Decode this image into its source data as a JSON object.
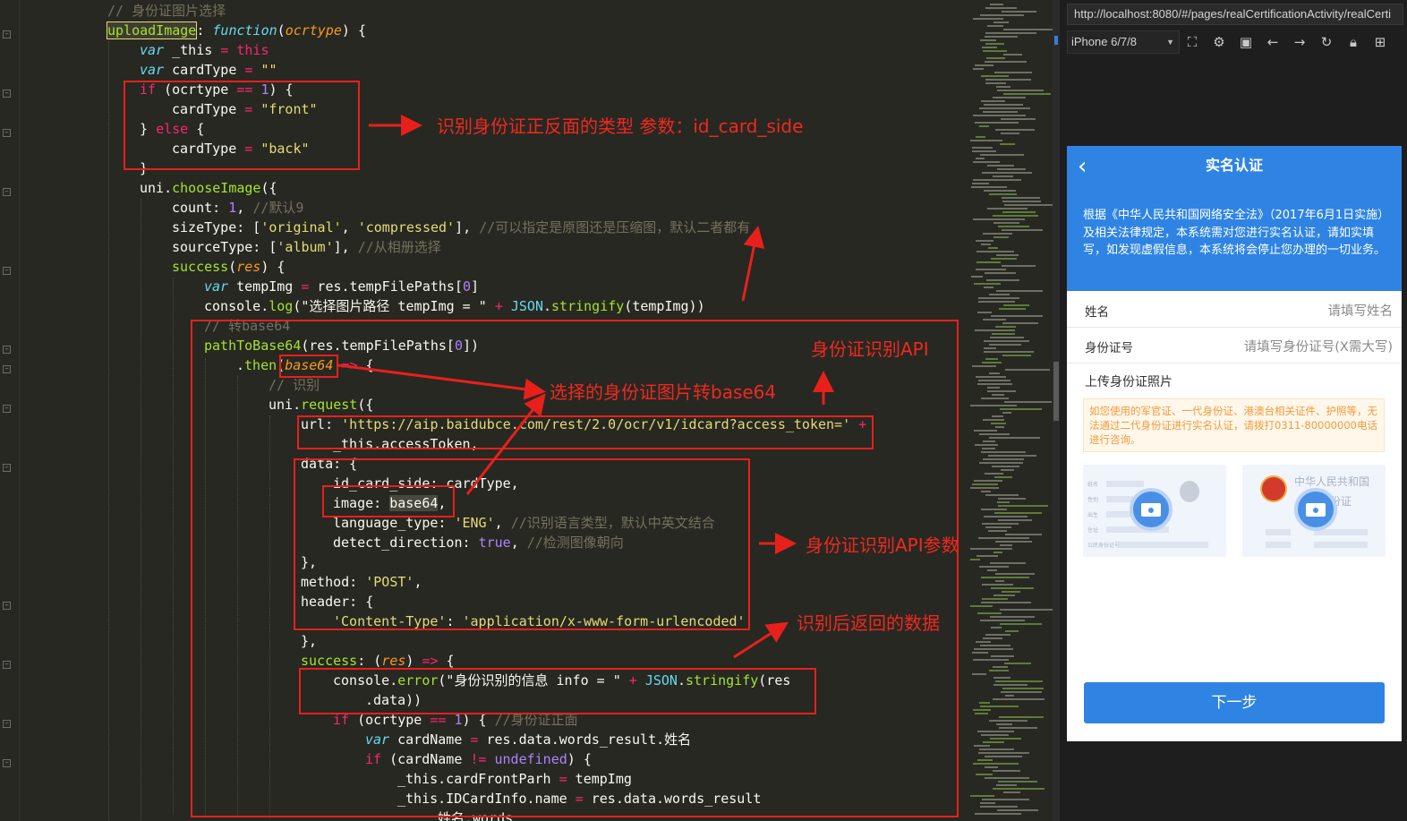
{
  "editor": {
    "lines": [
      [
        [
          "cm",
          "// 身份证图片选择"
        ]
      ],
      [
        [
          "sel",
          "uploadImage"
        ],
        [
          "prop",
          ": "
        ],
        [
          "kw",
          "function"
        ],
        [
          "prop",
          "("
        ],
        [
          "par",
          "ocrtype"
        ],
        [
          "prop",
          ") {"
        ]
      ],
      [
        [
          "kw",
          "var"
        ],
        [
          "prop",
          " _this "
        ],
        [
          "op",
          "="
        ],
        [
          "prop",
          " "
        ],
        [
          "op",
          "this"
        ]
      ],
      [
        [
          "kw",
          "var"
        ],
        [
          "prop",
          " cardType "
        ],
        [
          "op",
          "="
        ],
        [
          "prop",
          " "
        ],
        [
          "str",
          "\"\""
        ]
      ],
      [
        [
          "op",
          "if"
        ],
        [
          "prop",
          " (ocrtype "
        ],
        [
          "op",
          "=="
        ],
        [
          "prop",
          " "
        ],
        [
          "num",
          "1"
        ],
        [
          "prop",
          ") {"
        ]
      ],
      [
        [
          "prop",
          "cardType "
        ],
        [
          "op",
          "="
        ],
        [
          "prop",
          " "
        ],
        [
          "str",
          "\"front\""
        ]
      ],
      [
        [
          "prop",
          "} "
        ],
        [
          "op",
          "else"
        ],
        [
          "prop",
          " {"
        ]
      ],
      [
        [
          "prop",
          "cardType "
        ],
        [
          "op",
          "="
        ],
        [
          "prop",
          " "
        ],
        [
          "str",
          "\"back\""
        ]
      ],
      [
        [
          "prop",
          "}"
        ]
      ],
      [
        [
          "prop",
          "uni."
        ],
        [
          "fn",
          "chooseImage"
        ],
        [
          "prop",
          "({"
        ]
      ],
      [
        [
          "prop",
          "count: "
        ],
        [
          "num",
          "1"
        ],
        [
          "prop",
          ", "
        ],
        [
          "cm",
          "//默认9"
        ]
      ],
      [
        [
          "prop",
          "sizeType: ["
        ],
        [
          "str",
          "'original'"
        ],
        [
          "prop",
          ", "
        ],
        [
          "str",
          "'compressed'"
        ],
        [
          "prop",
          "], "
        ],
        [
          "cm",
          "//可以指定是原图还是压缩图，默认二者都有"
        ]
      ],
      [
        [
          "prop",
          "sourceType: ["
        ],
        [
          "str",
          "'album'"
        ],
        [
          "prop",
          "], "
        ],
        [
          "cm",
          "//从相册选择"
        ]
      ],
      [
        [
          "fn",
          "success"
        ],
        [
          "prop",
          "("
        ],
        [
          "par",
          "res"
        ],
        [
          "prop",
          ") {"
        ]
      ],
      [
        [
          "kw",
          "var"
        ],
        [
          "prop",
          " tempImg "
        ],
        [
          "op",
          "="
        ],
        [
          "prop",
          " res.tempFilePaths["
        ],
        [
          "num",
          "0"
        ],
        [
          "prop",
          "]"
        ]
      ],
      [
        [
          "prop",
          "console."
        ],
        [
          "fn",
          "log"
        ],
        [
          "prop",
          "(\"选择图片路径 tempImg = \" "
        ],
        [
          "op",
          "+"
        ],
        [
          "prop",
          " "
        ],
        [
          "obj",
          "JSON"
        ],
        [
          "prop",
          "."
        ],
        [
          "fn",
          "stringify"
        ],
        [
          "prop",
          "(tempImg))"
        ]
      ],
      [
        [
          "cm",
          "// 转base64"
        ]
      ],
      [
        [
          "fn",
          "pathToBase64"
        ],
        [
          "prop",
          "(res.tempFilePaths["
        ],
        [
          "num",
          "0"
        ],
        [
          "prop",
          "])"
        ]
      ],
      [
        [
          "prop",
          "."
        ],
        [
          "fn",
          "then"
        ],
        [
          "prop",
          "("
        ],
        [
          "par",
          "base64"
        ],
        [
          "prop",
          " "
        ],
        [
          "op",
          "=>"
        ],
        [
          "prop",
          " {"
        ]
      ],
      [
        [
          "cm",
          "// 识别"
        ]
      ],
      [
        [
          "prop",
          "uni."
        ],
        [
          "fn",
          "request"
        ],
        [
          "prop",
          "({"
        ]
      ],
      [
        [
          "prop",
          "url: "
        ],
        [
          "str",
          "'https://aip.baidubce.com/rest/2.0/ocr/v1/idcard?access_token='"
        ],
        [
          "prop",
          " "
        ],
        [
          "op",
          "+"
        ]
      ],
      [
        [
          "prop",
          "_this.accessToken,"
        ]
      ],
      [
        [
          "prop",
          "data: {"
        ]
      ],
      [
        [
          "prop",
          "id_card_side: cardType,"
        ]
      ],
      [
        [
          "prop",
          "image: "
        ],
        [
          "hl",
          "base64"
        ],
        [
          "prop",
          ","
        ]
      ],
      [
        [
          "prop",
          "language_type: "
        ],
        [
          "str",
          "'ENG'"
        ],
        [
          "prop",
          ", "
        ],
        [
          "cm",
          "//识别语言类型，默认中英文结合"
        ]
      ],
      [
        [
          "prop",
          "detect_direction: "
        ],
        [
          "num",
          "true"
        ],
        [
          "prop",
          ", "
        ],
        [
          "cm",
          "//检测图像朝向"
        ]
      ],
      [
        [
          "prop",
          "},"
        ]
      ],
      [
        [
          "prop",
          "method: "
        ],
        [
          "str",
          "'POST'"
        ],
        [
          "prop",
          ","
        ]
      ],
      [
        [
          "prop",
          "header: {"
        ]
      ],
      [
        [
          "str",
          "'Content-Type'"
        ],
        [
          "prop",
          ": "
        ],
        [
          "str",
          "'application/x-www-form-urlencoded'"
        ]
      ],
      [
        [
          "prop",
          "},"
        ]
      ],
      [
        [
          "fn",
          "success"
        ],
        [
          "prop",
          ": ("
        ],
        [
          "par",
          "res"
        ],
        [
          "prop",
          ") "
        ],
        [
          "op",
          "=>"
        ],
        [
          "prop",
          " {"
        ]
      ],
      [
        [
          "prop",
          "console."
        ],
        [
          "fn",
          "error"
        ],
        [
          "prop",
          "(\"身份识别的信息 info = \" "
        ],
        [
          "op",
          "+"
        ],
        [
          "prop",
          " "
        ],
        [
          "obj",
          "JSON"
        ],
        [
          "prop",
          "."
        ],
        [
          "fn",
          "stringify"
        ],
        [
          "prop",
          "(res"
        ]
      ],
      [
        [
          "prop",
          ".data))"
        ]
      ],
      [
        [
          "op",
          "if"
        ],
        [
          "prop",
          " (ocrtype "
        ],
        [
          "op",
          "=="
        ],
        [
          "prop",
          " "
        ],
        [
          "num",
          "1"
        ],
        [
          "prop",
          ") { "
        ],
        [
          "cm",
          "//身份证正面"
        ]
      ],
      [
        [
          "kw",
          "var"
        ],
        [
          "prop",
          " cardName "
        ],
        [
          "op",
          "="
        ],
        [
          "prop",
          " res.data.words_result.姓名"
        ]
      ],
      [
        [
          "op",
          "if"
        ],
        [
          "prop",
          " (cardName "
        ],
        [
          "op",
          "!="
        ],
        [
          "prop",
          " "
        ],
        [
          "num",
          "undefined"
        ],
        [
          "prop",
          ") {"
        ]
      ],
      [
        [
          "prop",
          "_this.cardFrontParh "
        ],
        [
          "op",
          "="
        ],
        [
          "prop",
          " tempImg"
        ]
      ],
      [
        [
          "prop",
          "_this.IDCardInfo.name "
        ],
        [
          "op",
          "="
        ],
        [
          "prop",
          " res.data.words_result"
        ]
      ],
      [
        [
          "prop",
          "姓名.words"
        ]
      ]
    ]
  },
  "annotations": {
    "id_card_side": "识别身份证正反面的类型 参数：id_card_side",
    "ocr_api": "身份证识别API",
    "to_base64": "选择的身份证图片转base64",
    "api_params": "身份证识别API参数",
    "return_data": "识别后返回的数据"
  },
  "browser": {
    "url": "http://localhost:8080/#/pages/realCertificationActivity/realCerti",
    "device": "iPhone 6/7/8"
  },
  "phone": {
    "title": "实名认证",
    "notice": "根据《中华人民共和国网络安全法》（2017年6月1日实施）及相关法律规定，本系统需对您进行实名认证，请如实填写，如发现虚假信息，本系统将会停止您办理的一切业务。",
    "name_label": "姓名",
    "name_placeholder": "请填写姓名",
    "id_label": "身份证号",
    "id_placeholder": "请填写身份证号(X需大写)",
    "upload_title": "上传身份证照片",
    "tip": "如您使用的军官证、一代身份证、港澳台相关证件、护照等，无法通过二代身份证进行实名认证，请拨打0311-80000000电话进行咨询。",
    "front_fields": [
      "姓名",
      "性别",
      "出生",
      "住址",
      "公民身份证号"
    ],
    "back_line1": "中华人民共和国",
    "back_line2": "居民身份证",
    "next_button": "下一步"
  },
  "colors": {
    "annotation_red": "#e8201b",
    "phone_header_blue": "#2f84e3",
    "editor_bg": "#272822"
  }
}
